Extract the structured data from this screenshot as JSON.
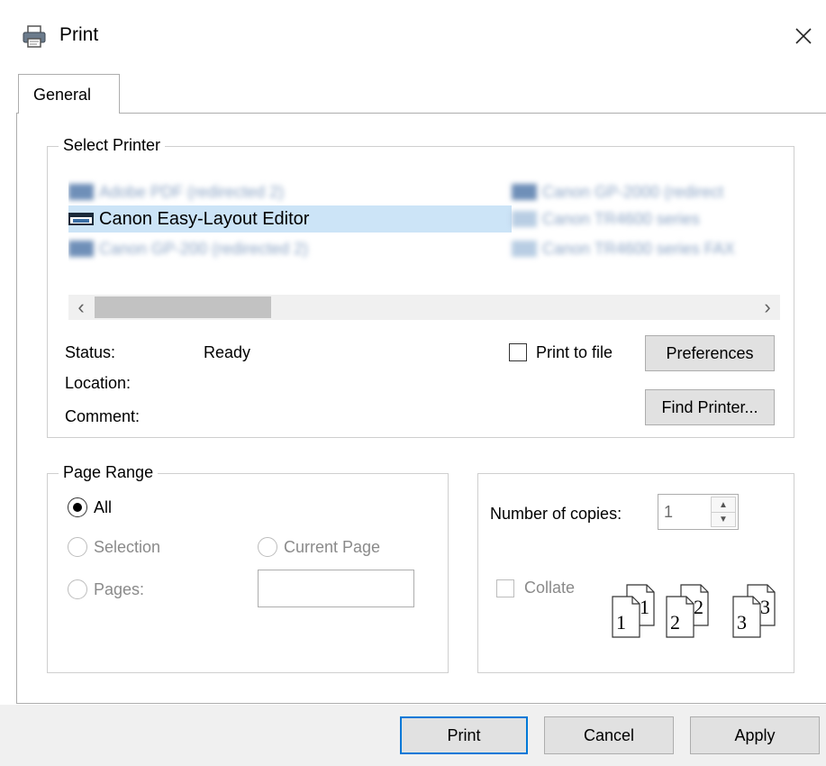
{
  "window": {
    "title": "Print",
    "close_glyph": "✕"
  },
  "tabs": [
    {
      "label": "General",
      "active": true
    }
  ],
  "select_printer": {
    "title": "Select Printer",
    "printers": [
      {
        "label": "Adobe PDF (redirected 2)",
        "blurred": true,
        "selected": false
      },
      {
        "label": "Canon Easy-Layout Editor",
        "blurred": false,
        "selected": true
      },
      {
        "label": "Canon GP-200 (redirected 2)",
        "blurred": true,
        "selected": false
      },
      {
        "label": "Canon GP-2000 (redirect",
        "blurred": true,
        "selected": false
      },
      {
        "label": "Canon TR4600 series",
        "blurred": true,
        "selected": false
      },
      {
        "label": "Canon TR4600 series FAX",
        "blurred": true,
        "selected": false
      }
    ],
    "scroll_left": "‹",
    "scroll_right": "›",
    "status_label": "Status:",
    "status_value": "Ready",
    "location_label": "Location:",
    "comment_label": "Comment:",
    "print_to_file_label": "Print to file",
    "preferences_label": "Preferences",
    "find_printer_label": "Find Printer..."
  },
  "page_range": {
    "title": "Page Range",
    "all_label": "All",
    "selection_label": "Selection",
    "current_page_label": "Current Page",
    "pages_label": "Pages:",
    "pages_value": ""
  },
  "copies": {
    "number_label": "Number of copies:",
    "number_value": "1",
    "collate_label": "Collate",
    "collate_pages": [
      "1",
      "1",
      "2",
      "2",
      "3",
      "3"
    ]
  },
  "footer": {
    "print_label": "Print",
    "cancel_label": "Cancel",
    "apply_label": "Apply"
  },
  "colors": {
    "accent": "#0078d7",
    "selection": "#cce4f7",
    "button_face": "#e1e1e1",
    "footer": "#f0f0f0"
  },
  "icons": {
    "title": "printer-icon",
    "close": "close-icon",
    "printer_item": "printer-icon",
    "spin_up": "spin-up-icon",
    "spin_down": "spin-down-icon",
    "collate": "collate-pages-icon"
  }
}
